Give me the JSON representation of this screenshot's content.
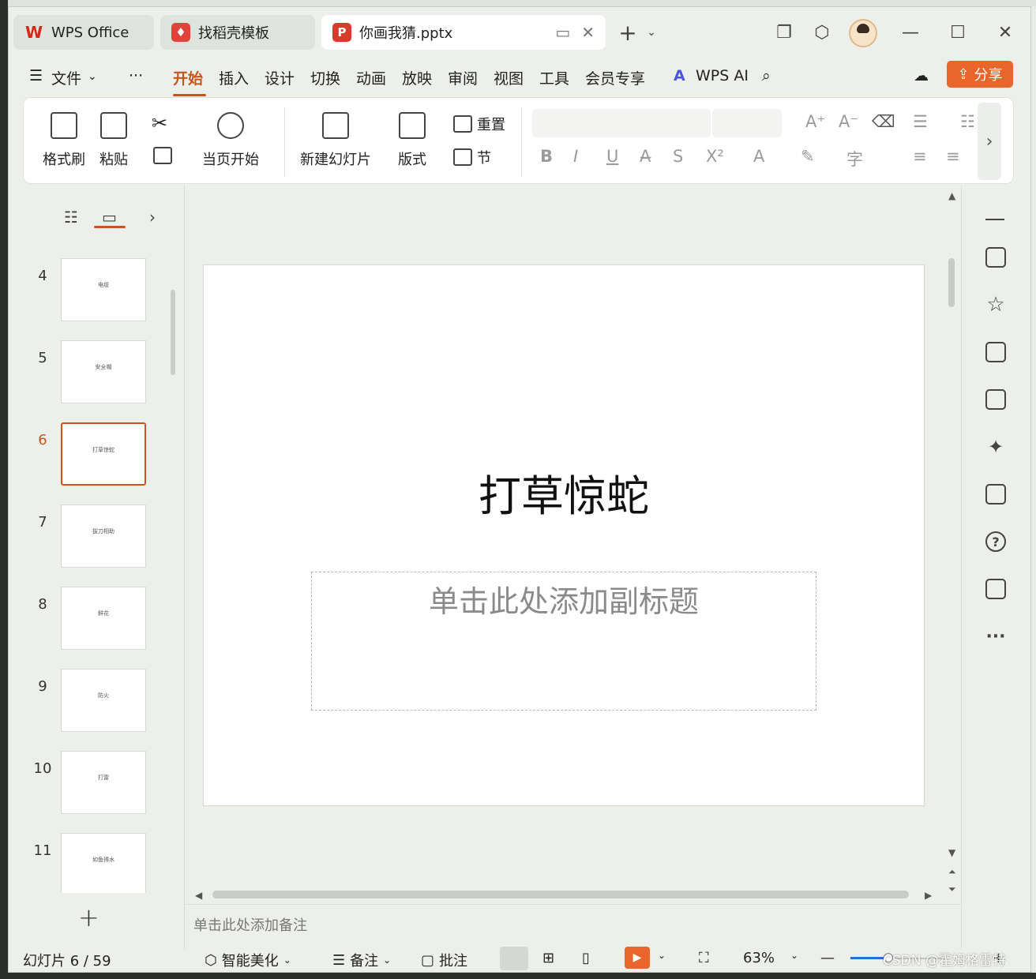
{
  "tabs": [
    {
      "label": "WPS Office"
    },
    {
      "label": "找稻壳模板"
    },
    {
      "label": "你画我猜.pptx"
    }
  ],
  "menu": {
    "file": "文件",
    "more": "···",
    "items": [
      "开始",
      "插入",
      "设计",
      "切换",
      "动画",
      "放映",
      "审阅",
      "视图",
      "工具",
      "会员专享"
    ],
    "ai": "WPS AI",
    "share": "分享"
  },
  "ribbon": {
    "format_painter": "格式刷",
    "paste": "粘贴",
    "play_from_current": "当页开始",
    "new_slide": "新建幻灯片",
    "layout": "版式",
    "reset": "重置",
    "section": "节"
  },
  "slides": [
    {
      "num": "4",
      "text": "电缆"
    },
    {
      "num": "5",
      "text": "安全帽"
    },
    {
      "num": "6",
      "text": "打草惊蛇"
    },
    {
      "num": "7",
      "text": "拔刀相助"
    },
    {
      "num": "8",
      "text": "鲜花"
    },
    {
      "num": "9",
      "text": "防火"
    },
    {
      "num": "10",
      "text": "打雷"
    },
    {
      "num": "11",
      "text": "如鱼得水"
    }
  ],
  "current_slide": {
    "title": "打草惊蛇",
    "subtitle_placeholder": "单击此处添加副标题"
  },
  "notes_placeholder": "单击此处添加备注",
  "status": {
    "slide_counter": "幻灯片 6 / 59",
    "smart_beautify": "智能美化",
    "notes": "备注",
    "comments": "批注",
    "zoom": "63%",
    "zoom_fraction": 0.4
  },
  "watermark": "CSDN @霍姆格雷特",
  "colors": {
    "accent": "#c7561e",
    "share": "#e8662b"
  }
}
